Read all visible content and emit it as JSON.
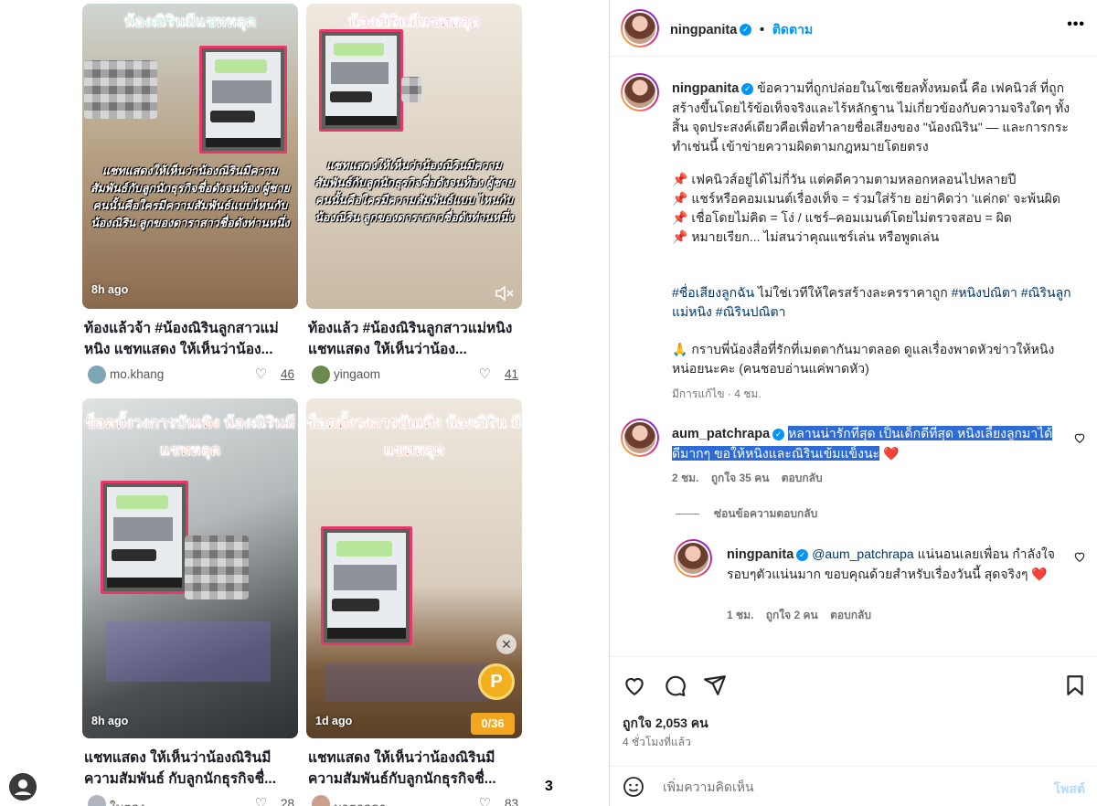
{
  "feed": {
    "cards": [
      {
        "overlay_title": "น้องณิรินมีแชทหลุด",
        "overlay_caption": "แชทแสดงให้เห็นว่าน้องณิรินมีความสัมพันธ์กับลูกนักธุรกิจชื่อดังจนท้อง ผู้ชายคนนั้นคือใครมีความสัมพันธ์แบบไหนกับน้องณิริน ลูกของดาราสาวชื่อดังท่านหนึ่ง",
        "time": "8h ago",
        "title": "ท้องแล้วจ้า #น้องณิรินลูกสาวแม่หนิง แชทแสดง ให้เห็นว่าน้อง...",
        "author": "mo.khang",
        "likes": "46"
      },
      {
        "overlay_title": "น้องณิรินมีแชทหลุด",
        "overlay_caption": "แชทแสดงให้เห็นว่าน้องณิรินมีความสัมพันธ์กับลูกนักธุรกิจชื่อดังจนท้อง ผู้ชายคนนั้นคือใครมีความสัมพันธ์แบบ ไหนกับน้องณิริน ลูกของดาราสาวชื่อดังท่านหนึ่ง",
        "time": "",
        "title": "ท้องแล้ว #น้องณิรินลูกสาวแม่หนิง แชทแสดง ให้เห็นว่าน้อง...",
        "author": "yingaom",
        "likes": "41"
      },
      {
        "overlay_title": "ช็อคทั้งวงการบันเทิง น้องณิรินมีแชทหลุด",
        "overlay_caption": "",
        "time": "8h ago",
        "title": "แชทแสดง ให้เห็นว่าน้องณิรินมีความสัมพันธ์ กับลูกนักธุรกิจชื่...",
        "author": "ใบตอง",
        "likes": "28"
      },
      {
        "overlay_title": "ช็อคทั้งวงการบันเทิง น้องณิริน มีแชทหลุด",
        "overlay_caption": "",
        "time": "1d ago",
        "title": "แชทแสดง ให้เห็นว่าน้องณิรินมีความสัมพันธ์กับลูกนักธุรกิจชื่...",
        "author": "มาตาลดา",
        "likes": "83",
        "coin_label": "P",
        "counter": "0/36"
      }
    ],
    "page_number": "3"
  },
  "post": {
    "header_username": "ningpanita",
    "follow_label": "ติดตาม",
    "more_label": "•••",
    "caption_username": "ningpanita",
    "caption_p1": "ข้อความที่ถูกปล่อยในโซเชียลทั้งหมดนี้ คือ เฟคนิวส์ ที่ถูกสร้างขึ้นโดยไร้ข้อเท็จจริงและไร้หลักฐาน ไม่เกี่ยวข้องกับความจริงใดๆ ทั้งสิ้น จุดประสงค์เดียวคือเพื่อทำลายชื่อเสียงของ \"น้องณิริน\" — และการกระทำเช่นนี้ เข้าข่ายความผิดตามกฎหมายโดยตรง",
    "bullets": [
      "เฟคนิวส์อยู่ได้ไม่กี่วัน แต่คดีความตามหลอกหลอนไปหลายปี",
      "แชร์หรือคอมเมนต์เรื่องเท็จ = ร่วมใส่ร้าย อย่าคิดว่า 'แค่กด' จะพ้นผิด",
      "เชื่อโดยไม่คิด = โง่ / แชร์–คอมเมนต์โดยไม่ตรวจสอบ = ผิด",
      "หมายเรียก... ไม่สนว่าคุณแชร์เล่น หรือพูดเล่น"
    ],
    "bullet_icon": "📌",
    "hashtags_a": "#ชื่อเสียงลูกฉัน",
    "hashtags_mid": " ไม่ใช่เวทีให้ใครสร้างละครราคาถูก ",
    "hashtags_b": "#หนิงปณิตา #ณิรินลูกแม่หนิง #ณิรินปณิตา",
    "thanks": "🙏 กราบพี่น้องสื่อที่รักที่เมตตากันมาตลอด ดูแลเรื่องพาดหัวข่าวให้หนิงหน่อยนะคะ (คนชอบอ่านแค่พาดหัว)",
    "edited": "มีการแก้ไข · 4 ชม.",
    "comments": [
      {
        "username": "aum_patchrapa",
        "text": "หลานน่ารักที่สุด เป็นเด็กดีที่สุด หนิงเลี้ยงลูกมาได้ดีมากๆ ขอให้หนิงและณิรินเข้มแข็งนะ",
        "emoji": "❤️",
        "time": "2 ชม.",
        "likes": "ถูกใจ 35 คน",
        "reply": "ตอบกลับ",
        "hide_replies": "ซ่อนข้อความตอบกลับ"
      },
      {
        "username": "ningpanita",
        "mention": "@aum_patchrapa",
        "text": " แน่นอนเลยเพื่อน กำลังใจรอบๆตัวแน่นมาก ขอบคุณด้วยสำหรับเรื่องวันนี้ สุดจริงๆ",
        "emoji": "❤️",
        "time": "1 ชม.",
        "likes": "ถูกใจ 2 คน",
        "reply": "ตอบกลับ"
      }
    ],
    "like_count": "ถูกใจ 2,053 คน",
    "posted": "4 ชั่วโมงที่แล้ว",
    "comment_placeholder": "เพิ่มความคิดเห็น",
    "post_button": "โพสต์"
  },
  "colors": {
    "accent": "#0095f6",
    "highlight": "#2e6bd6",
    "like_red": "#ed4956",
    "frame_pink": "#e8376a"
  }
}
